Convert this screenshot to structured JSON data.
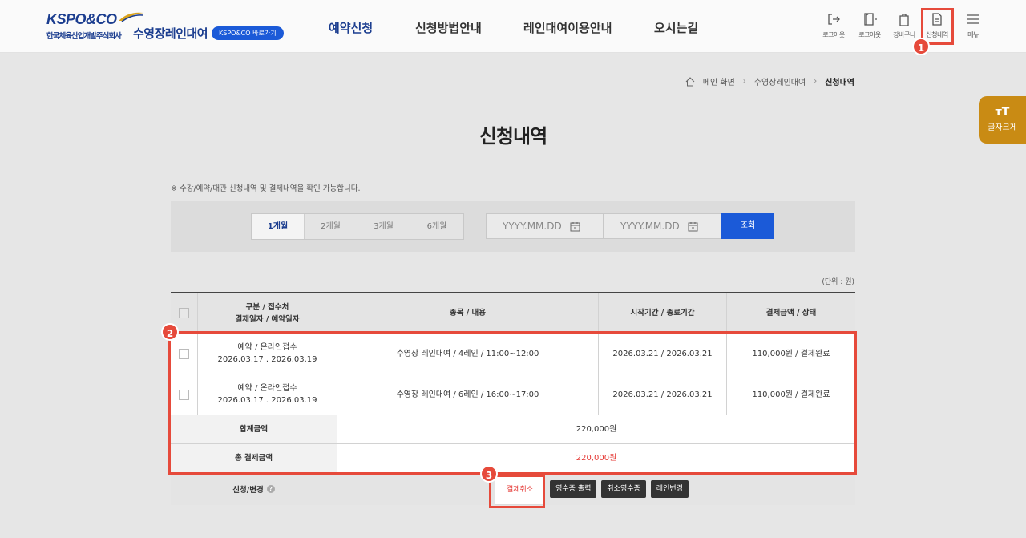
{
  "header": {
    "logo_text": "KSPO&CO",
    "logo_sub": "한국체육산업개발주식회사",
    "site_title": "수영장레인대여",
    "shortcut_label": "KSPO&CO 바로가기",
    "nav": [
      "예약신청",
      "신청방법안내",
      "레인대여이용안내",
      "오시는길"
    ],
    "utils": [
      "로그아웃",
      "로그아웃",
      "장바구니",
      "신청내역",
      "메뉴"
    ]
  },
  "breadcrumb": {
    "home": "메인 화면",
    "level1": "수영장레인대여",
    "current": "신청내역"
  },
  "font_tab": {
    "icon": "тT",
    "label": "글자크게"
  },
  "page_title": "신청내역",
  "notice": "※ 수강/예약/대관 신청내역 및 결제내역을 확인 가능합니다.",
  "search": {
    "periods": [
      "1개월",
      "2개월",
      "3개월",
      "6개월"
    ],
    "selected_period": "1개월",
    "start_placeholder": "YYYY.MM.DD",
    "end_placeholder": "YYYY.MM.DD",
    "button": "조회"
  },
  "unit": "(단위 : 원)",
  "table": {
    "headers": {
      "col1_line1": "구분 /  접수처",
      "col1_line2": "결제일자 / 예약일자",
      "col2": "종목 / 내용",
      "col3": "시작기간 / 종료기간",
      "col4": "결제금액 / 상태"
    },
    "rows": [
      {
        "type": "예약 / 온라인접수",
        "dates": "2026.03.17 . 2026.03.19",
        "content": "수영장 레인대여 / 4레인 / 11:00~12:00",
        "period": "2026.03.21 /  2026.03.21",
        "amount": "110,000원 / 결제완료"
      },
      {
        "type": "예약 / 온라인접수",
        "dates": "2026.03.17 . 2026.03.19",
        "content": "수영장 레인대여 / 6레인 / 16:00~17:00",
        "period": "2026.03.21 /  2026.03.21",
        "amount": "110,000원 / 결제완료"
      }
    ],
    "total_label": "합계금액",
    "total_value": "220,000원",
    "grand_total_label": "총 결제금액",
    "grand_total_value": "220,000원",
    "action_label": "신청/변경",
    "action_help_icon": "?",
    "actions": [
      "결제취소",
      "영수증 출력",
      "취소영수증",
      "레인변경"
    ]
  },
  "annotations": [
    "1",
    "2",
    "3"
  ],
  "colors": {
    "brand": "#1b3d8f",
    "accent_blue": "#1b5ad8",
    "highlight": "#e64a3b",
    "font_tab": "#c98b14",
    "red_text": "#e53935"
  }
}
